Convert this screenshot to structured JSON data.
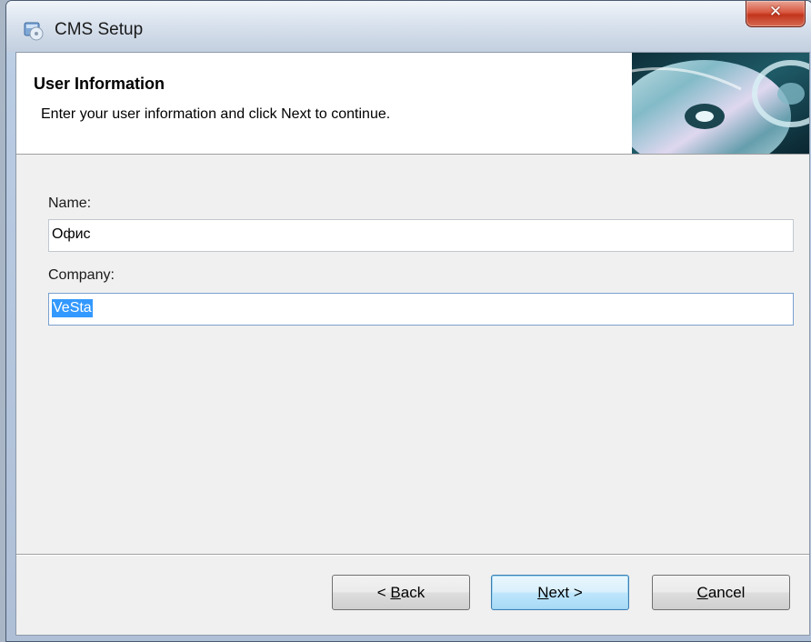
{
  "window": {
    "title": "CMS Setup"
  },
  "header": {
    "title": "User Information",
    "subtitle": "Enter your user information and click Next to continue."
  },
  "form": {
    "name_label": "Name:",
    "name_value": "Офис",
    "company_label": "Company:",
    "company_value": "VeSta"
  },
  "buttons": {
    "back_mnemonic": "B",
    "back_rest": "ack",
    "back_prefix": "< ",
    "next_mnemonic": "N",
    "next_rest": "ext >",
    "cancel_mnemonic": "C",
    "cancel_rest": "ancel"
  },
  "icons": {
    "title": "setup-cd-icon",
    "close": "close-icon",
    "banner": "cd-disc-icon"
  },
  "colors": {
    "selection": "#3399ff",
    "close_button": "#c94a33"
  }
}
